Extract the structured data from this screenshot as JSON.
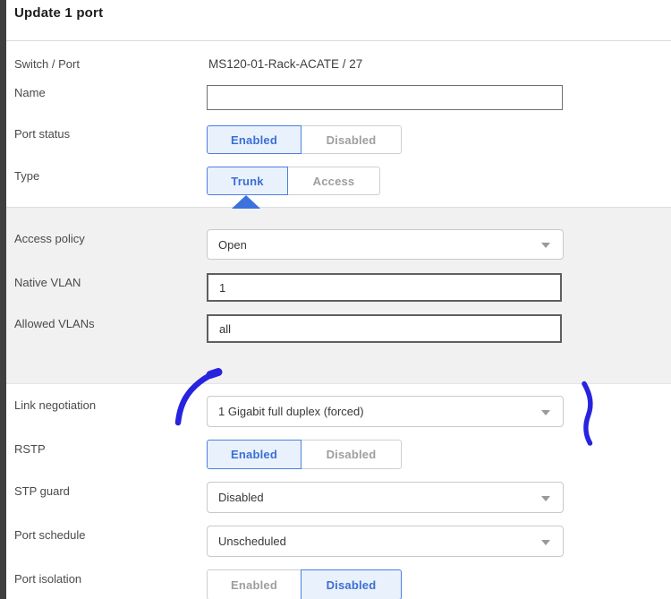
{
  "header": {
    "title": "Update 1 port"
  },
  "colors": {
    "accent_blue": "#3b6fd4",
    "selected_bg": "#e9f1fc",
    "selected_border": "#4b80e0",
    "unselected_text": "#9e9e9e",
    "gray_band_bg": "#f1f1f1",
    "pen_blue": "#2823df",
    "pointer_blue": "#3b72dd"
  },
  "rows": {
    "switch_port": {
      "label": "Switch / Port",
      "value": "MS120-01-Rack-ACATE / 27"
    },
    "name": {
      "label": "Name",
      "value": ""
    },
    "port_status": {
      "label": "Port status",
      "options": [
        "Enabled",
        "Disabled"
      ],
      "selected": "Enabled"
    },
    "type": {
      "label": "Type",
      "options": [
        "Trunk",
        "Access"
      ],
      "selected": "Trunk"
    },
    "access_policy": {
      "label": "Access policy",
      "value": "Open"
    },
    "native_vlan": {
      "label": "Native VLAN",
      "value": "1"
    },
    "allowed_vlans": {
      "label": "Allowed VLANs",
      "value": "all"
    },
    "link_negotiation": {
      "label": "Link negotiation",
      "value": "1 Gigabit full duplex (forced)"
    },
    "rstp": {
      "label": "RSTP",
      "options": [
        "Enabled",
        "Disabled"
      ],
      "selected": "Enabled"
    },
    "stp_guard": {
      "label": "STP guard",
      "value": "Disabled"
    },
    "port_schedule": {
      "label": "Port schedule",
      "value": "Unscheduled"
    },
    "port_isolation": {
      "label": "Port isolation",
      "options": [
        "Enabled",
        "Disabled"
      ],
      "selected": "Disabled"
    }
  }
}
